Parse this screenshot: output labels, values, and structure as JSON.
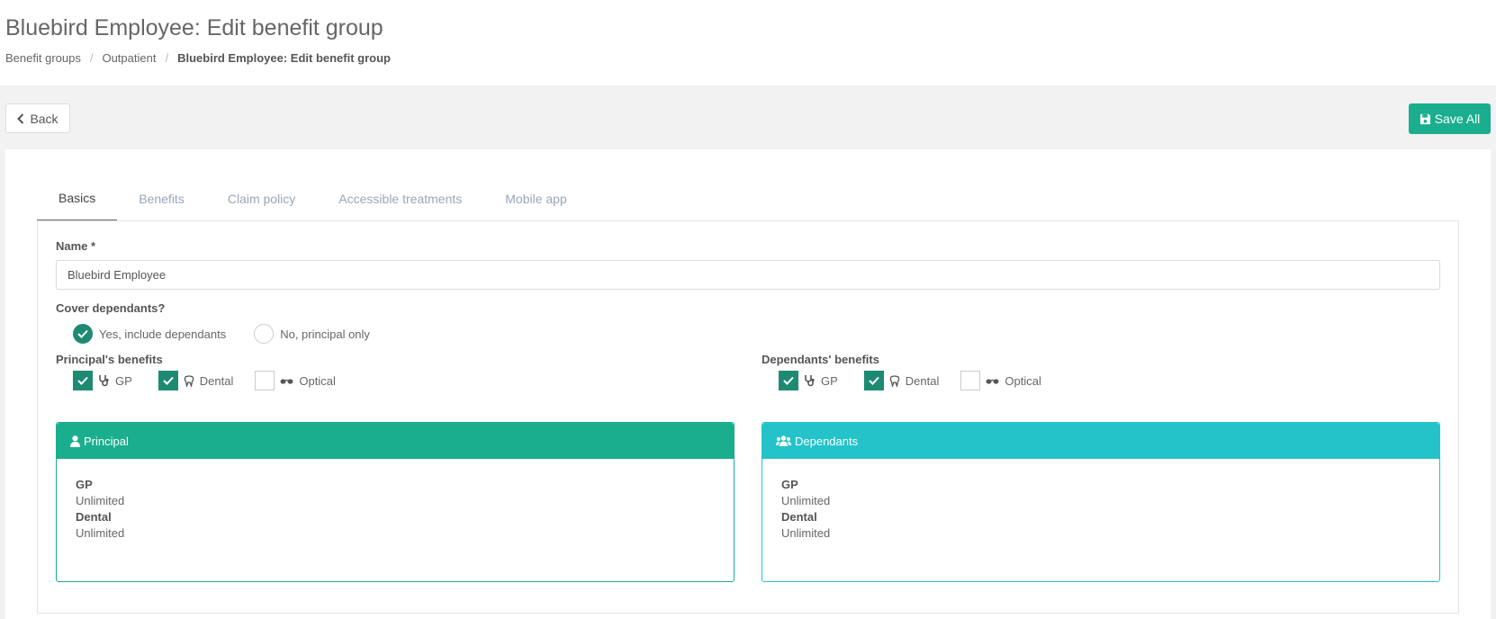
{
  "header": {
    "title": "Bluebird Employee: Edit benefit group",
    "breadcrumb": [
      "Benefit groups",
      "Outpatient",
      "Bluebird Employee: Edit benefit group"
    ]
  },
  "toolbar": {
    "back_label": "Back",
    "save_label": "Save All",
    "save_color": "#1aae8e"
  },
  "tabs": [
    {
      "label": "Basics",
      "active": true
    },
    {
      "label": "Benefits",
      "active": false
    },
    {
      "label": "Claim policy",
      "active": false
    },
    {
      "label": "Accessible treatments",
      "active": false
    },
    {
      "label": "Mobile app",
      "active": false
    }
  ],
  "form": {
    "name_label": "Name *",
    "name_value": "Bluebird Employee",
    "cover_label": "Cover dependants?",
    "cover_options": [
      {
        "label": "Yes, include dependants",
        "selected": true
      },
      {
        "label": "No, principal only",
        "selected": false
      }
    ],
    "principal_benefits_label": "Principal's benefits",
    "principal_benefits": [
      {
        "label": "GP",
        "icon": "stethoscope-icon",
        "checked": true
      },
      {
        "label": "Dental",
        "icon": "tooth-icon",
        "checked": true
      },
      {
        "label": "Optical",
        "icon": "glasses-icon",
        "checked": false
      }
    ],
    "dependants_benefits_label": "Dependants' benefits",
    "dependants_benefits": [
      {
        "label": "GP",
        "icon": "stethoscope-icon",
        "checked": true
      },
      {
        "label": "Dental",
        "icon": "tooth-icon",
        "checked": true
      },
      {
        "label": "Optical",
        "icon": "glasses-icon",
        "checked": false
      }
    ]
  },
  "principal_card": {
    "title": "Principal",
    "icon": "user-icon",
    "color": "#1aae8e",
    "items": [
      {
        "name": "GP",
        "value": "Unlimited"
      },
      {
        "name": "Dental",
        "value": "Unlimited"
      }
    ]
  },
  "dependants_card": {
    "title": "Dependants",
    "icon": "users-icon",
    "color": "#23c3c9",
    "items": [
      {
        "name": "GP",
        "value": "Unlimited"
      },
      {
        "name": "Dental",
        "value": "Unlimited"
      }
    ]
  }
}
